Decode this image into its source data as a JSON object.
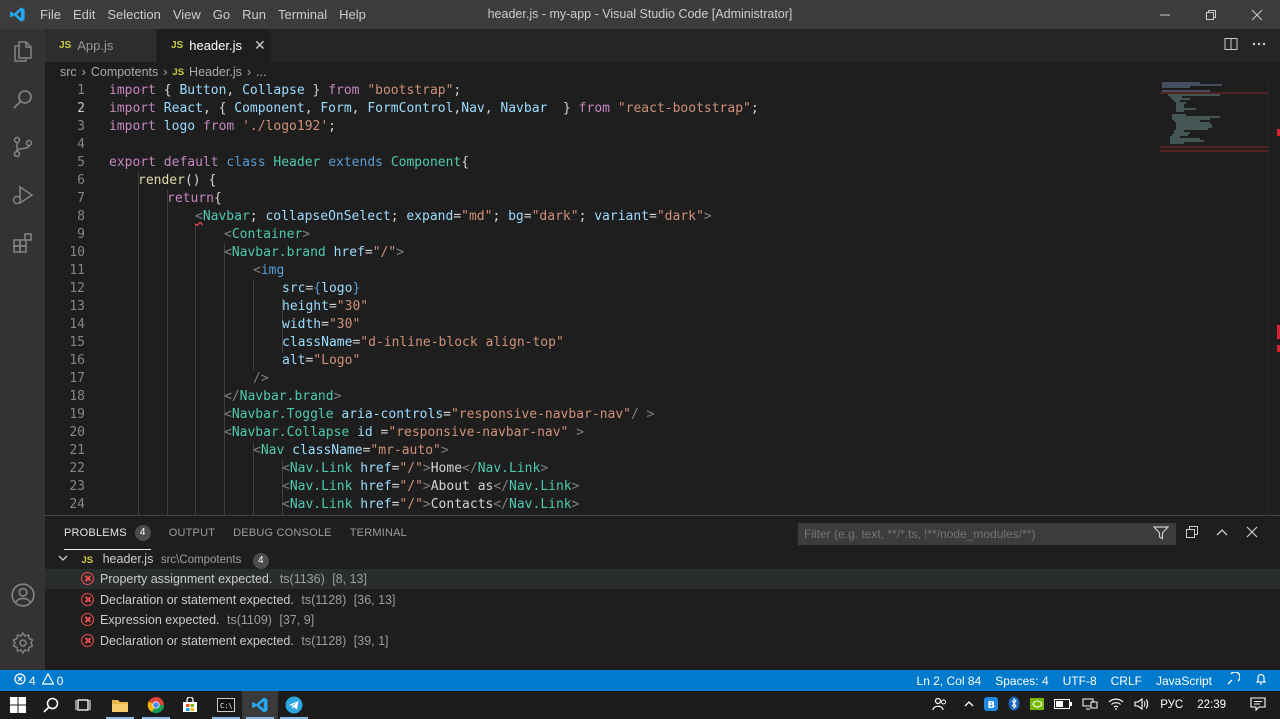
{
  "titlebar": {
    "menu": [
      "File",
      "Edit",
      "Selection",
      "View",
      "Go",
      "Run",
      "Terminal",
      "Help"
    ],
    "title": "header.js - my-app - Visual Studio Code [Administrator]",
    "logo_icon": "vscode-logo-icon",
    "controls": [
      "minimize-icon",
      "restore-icon",
      "close-icon"
    ]
  },
  "activity_bar": {
    "icons": [
      "files-icon",
      "search-icon",
      "source-control-icon",
      "run-debug-icon",
      "extensions-icon",
      "account-icon",
      "gear-icon"
    ]
  },
  "tabs": [
    {
      "label": "App.js",
      "badge": "JS",
      "active": false
    },
    {
      "label": "header.js",
      "badge": "JS",
      "active": true,
      "close": "✕"
    }
  ],
  "breadcrumb": {
    "items": [
      "src",
      "Compotents",
      "Header.js",
      "..."
    ],
    "file_badge": "JS"
  },
  "editor": {
    "current_line": 2,
    "lines": [
      {
        "n": "1"
      },
      {
        "n": "2"
      },
      {
        "n": "3"
      },
      {
        "n": "4"
      },
      {
        "n": "5"
      },
      {
        "n": "6"
      },
      {
        "n": "7"
      },
      {
        "n": "8"
      },
      {
        "n": "9"
      },
      {
        "n": "10"
      },
      {
        "n": "11"
      },
      {
        "n": "12"
      },
      {
        "n": "13"
      },
      {
        "n": "14"
      },
      {
        "n": "15"
      },
      {
        "n": "16"
      },
      {
        "n": "17"
      },
      {
        "n": "18"
      },
      {
        "n": "19"
      },
      {
        "n": "20"
      },
      {
        "n": "21"
      },
      {
        "n": "22"
      },
      {
        "n": "23"
      },
      {
        "n": "24"
      }
    ],
    "code": {
      "l1": [
        "import",
        " { ",
        "Button",
        ", ",
        "Collapse",
        " } ",
        "from",
        " ",
        "\"bootstrap\"",
        ";"
      ],
      "l2": [
        "import",
        " ",
        "React",
        ", { ",
        "Component",
        ", ",
        "Form",
        ", ",
        "FormControl",
        ",",
        "Nav",
        ", ",
        "Navbar",
        "  } ",
        "from",
        " ",
        "\"react-bootstrap\"",
        ";"
      ],
      "l3": [
        "import",
        " ",
        "logo",
        " ",
        "from",
        " ",
        "'./logo192'",
        ";"
      ],
      "l5": [
        "export",
        " ",
        "default",
        " ",
        "class",
        " ",
        "Header",
        " ",
        "extends",
        " ",
        "Component",
        "{"
      ],
      "l6": [
        "render",
        "() {"
      ],
      "l7": [
        "return",
        "{"
      ],
      "l8": [
        "<",
        "Navbar",
        "; ",
        "collapseOnSelect",
        "; ",
        "expand",
        "=",
        "\"md\"",
        "; ",
        "bg",
        "=",
        "\"dark\"",
        "; ",
        "variant",
        "=",
        "\"dark\"",
        ">"
      ],
      "l9": [
        "<",
        "Container",
        ">"
      ],
      "l10": [
        "<",
        "Navbar.brand",
        " ",
        "href",
        "=",
        "\"/\"",
        ">"
      ],
      "l11": [
        "<",
        "img"
      ],
      "l12": [
        "src",
        "=",
        "{",
        "logo",
        "}"
      ],
      "l13": [
        "height",
        "=",
        "\"30\""
      ],
      "l14": [
        "width",
        "=",
        "\"30\""
      ],
      "l15": [
        "className",
        "=",
        "\"d-inline-block align-top\""
      ],
      "l16": [
        "alt",
        "=",
        "\"Logo\""
      ],
      "l17": [
        "/>"
      ],
      "l18": [
        "</",
        "Navbar.brand",
        ">"
      ],
      "l19": [
        "<",
        "Navbar.Toggle",
        " ",
        "aria-controls",
        "=",
        "\"responsive-navbar-nav\"",
        "/ >"
      ],
      "l20": [
        "<",
        "Navbar.Collapse",
        " ",
        "id",
        " =",
        "\"responsive-navbar-nav\"",
        " >"
      ],
      "l21": [
        "<",
        "Nav",
        " ",
        "className",
        "=",
        "\"mr-auto\"",
        ">"
      ],
      "l22": [
        "<",
        "Nav.Link",
        " ",
        "href",
        "=",
        "\"/\"",
        ">",
        "Home",
        "</",
        "Nav.Link",
        ">"
      ],
      "l23": [
        "<",
        "Nav.Link",
        " ",
        "href",
        "=",
        "\"/\"",
        ">",
        "About as",
        "</",
        "Nav.Link",
        ">"
      ],
      "l24": [
        "<",
        "Nav.Link",
        " ",
        "href",
        "=",
        "\"/\"",
        ">",
        "Contacts",
        "</",
        "Nav.Link",
        ">"
      ]
    }
  },
  "panel": {
    "tabs": [
      {
        "label": "PROBLEMS",
        "badge": "4",
        "active": true
      },
      {
        "label": "OUTPUT"
      },
      {
        "label": "DEBUG CONSOLE"
      },
      {
        "label": "TERMINAL"
      }
    ],
    "filter_placeholder": "Filter (e.g. text, **/*.ts, !**/node_modules/**)",
    "file": {
      "name": "header.js",
      "path": "src\\Compotents",
      "count": "4",
      "badge": "JS"
    },
    "problems": [
      {
        "message": "Property assignment expected.",
        "code": "ts(1136)",
        "pos": "[8, 13]"
      },
      {
        "message": "Declaration or statement expected.",
        "code": "ts(1128)",
        "pos": "[36, 13]"
      },
      {
        "message": "Expression expected.",
        "code": "ts(1109)",
        "pos": "[37, 9]"
      },
      {
        "message": "Declaration or statement expected.",
        "code": "ts(1128)",
        "pos": "[39, 1]"
      }
    ]
  },
  "statusbar": {
    "errors": "4",
    "warnings": "0",
    "position": "Ln 2, Col 84",
    "spaces": "Spaces: 4",
    "encoding": "UTF-8",
    "eol": "CRLF",
    "language": "JavaScript"
  },
  "taskbar": {
    "language": "РУС",
    "time": "22:39"
  },
  "colors": {
    "statusbar": "#007acc",
    "error": "#f14c4c",
    "editor_bg": "#1e1e1e"
  }
}
